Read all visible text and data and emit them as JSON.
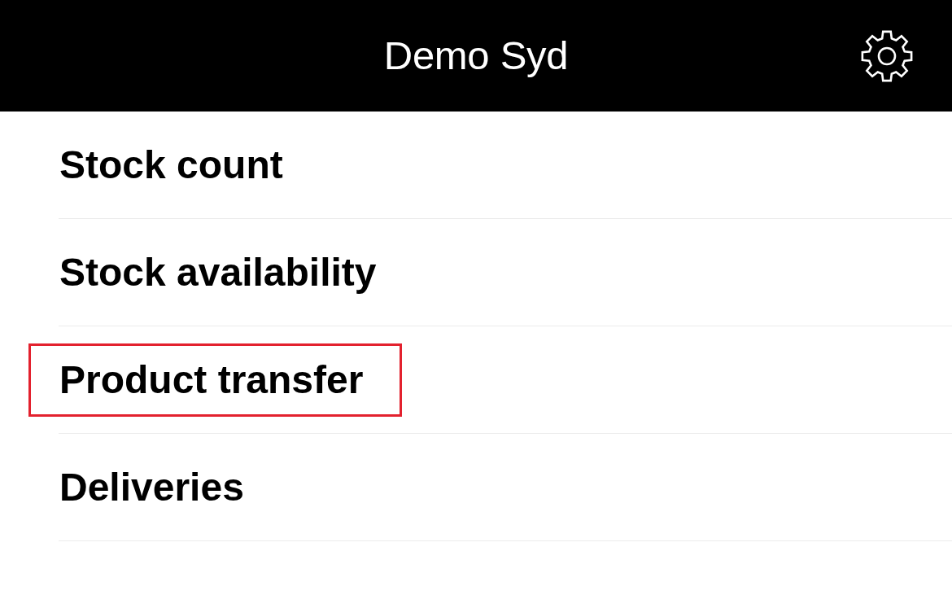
{
  "header": {
    "title": "Demo Syd"
  },
  "menu": [
    {
      "label": "Stock count",
      "highlighted": false
    },
    {
      "label": "Stock availability",
      "highlighted": false
    },
    {
      "label": "Product transfer",
      "highlighted": true
    },
    {
      "label": "Deliveries",
      "highlighted": false
    }
  ]
}
